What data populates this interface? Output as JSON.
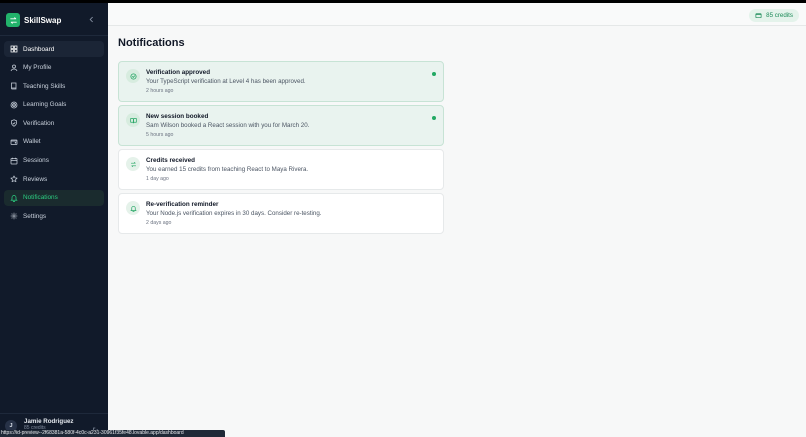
{
  "app": {
    "name": "SkillSwap"
  },
  "sidebar": {
    "items": [
      {
        "label": "Dashboard",
        "icon": "dashboard-icon"
      },
      {
        "label": "My Profile",
        "icon": "user-icon"
      },
      {
        "label": "Teaching Skills",
        "icon": "book-icon"
      },
      {
        "label": "Learning Goals",
        "icon": "target-icon"
      },
      {
        "label": "Verification",
        "icon": "shield-check-icon"
      },
      {
        "label": "Wallet",
        "icon": "wallet-icon"
      },
      {
        "label": "Sessions",
        "icon": "calendar-icon"
      },
      {
        "label": "Reviews",
        "icon": "star-icon"
      },
      {
        "label": "Notifications",
        "icon": "bell-icon"
      },
      {
        "label": "Settings",
        "icon": "gear-icon"
      }
    ]
  },
  "user": {
    "initial": "J",
    "name": "Jamie Rodriguez",
    "credits": "85 credits"
  },
  "topbar": {
    "credits": "85 credits"
  },
  "main": {
    "title": "Notifications",
    "notifications": [
      {
        "title": "Verification approved",
        "text": "Your TypeScript verification at Level 4 has been approved.",
        "time": "2 hours ago",
        "unread": true,
        "icon": "check-circle-icon"
      },
      {
        "title": "New session booked",
        "text": "Sam Wilson booked a React session with you for March 20.",
        "time": "5 hours ago",
        "unread": true,
        "icon": "book-open-icon"
      },
      {
        "title": "Credits received",
        "text": "You earned 15 credits from teaching React to Maya Rivera.",
        "time": "1 day ago",
        "unread": false,
        "icon": "transfer-icon"
      },
      {
        "title": "Re-verification reminder",
        "text": "Your Node.js verification expires in 30 days. Consider re-testing.",
        "time": "2 days ago",
        "unread": false,
        "icon": "bell-icon"
      }
    ]
  },
  "status_url": "https://id-preview--2f68381a-580f-4c0c-a231-30961f35fe48.lovable.app/dashboard",
  "colors": {
    "sidebar_bg": "#111a2a",
    "accent": "#22b36b"
  }
}
